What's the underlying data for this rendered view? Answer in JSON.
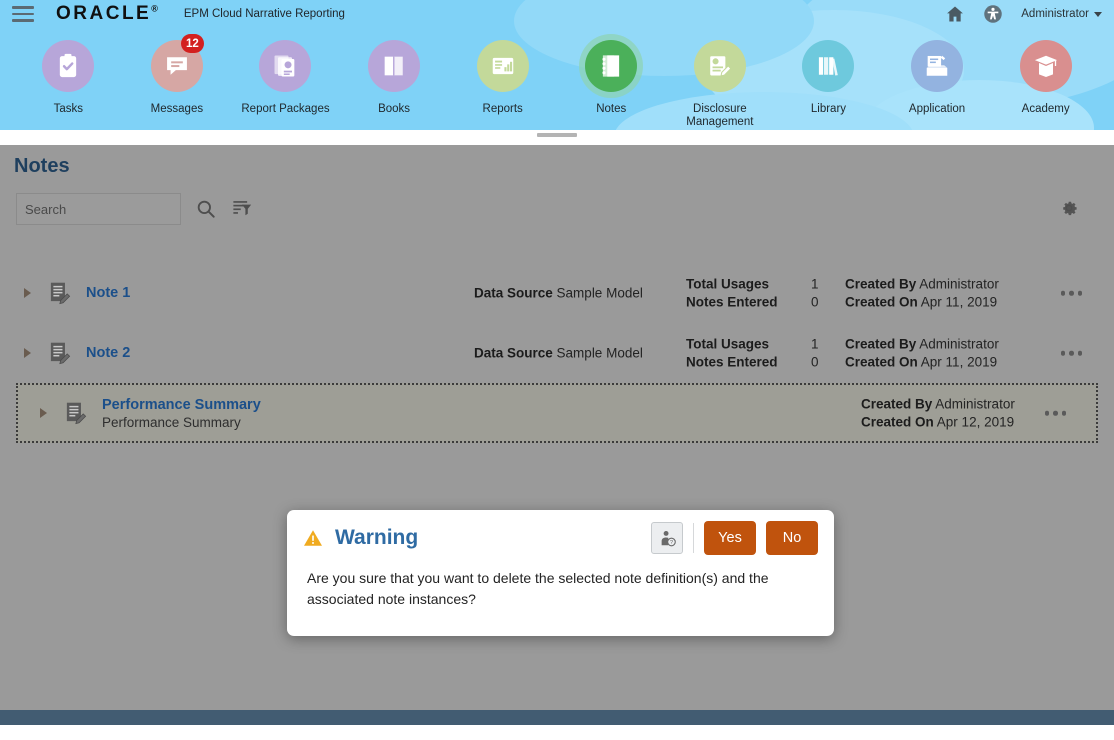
{
  "header": {
    "menu_icon": "hamburger-icon",
    "logo": "ORACLE",
    "logo_mark": "®",
    "app_title": "EPM Cloud Narrative Reporting",
    "home_icon": "home-icon",
    "accessibility_icon": "accessibility-icon",
    "user_name": "Administrator"
  },
  "nav": {
    "items": [
      {
        "label": "Tasks",
        "icon": "clipboard-check-icon",
        "circle": "#b7a6d9",
        "active": false,
        "badge": ""
      },
      {
        "label": "Messages",
        "icon": "chat-bubble-icon",
        "circle": "#d6a7a4",
        "active": false,
        "badge": "12"
      },
      {
        "label": "Report Packages",
        "icon": "report-stack-icon",
        "circle": "#b7a6d9",
        "active": false,
        "badge": ""
      },
      {
        "label": "Books",
        "icon": "book-icon",
        "circle": "#b7a6d9",
        "active": false,
        "badge": ""
      },
      {
        "label": "Reports",
        "icon": "report-chart-icon",
        "circle": "#c3d99a",
        "active": false,
        "badge": ""
      },
      {
        "label": "Notes",
        "icon": "notebook-icon",
        "circle": "#4bb05a",
        "active": true,
        "badge": ""
      },
      {
        "label": "Disclosure Management",
        "icon": "disclosure-edit-icon",
        "circle": "#c3d99a",
        "active": false,
        "badge": ""
      },
      {
        "label": "Library",
        "icon": "library-books-icon",
        "circle": "#6ec9dd",
        "active": false,
        "badge": ""
      },
      {
        "label": "Application",
        "icon": "application-tray-icon",
        "circle": "#93b3e0",
        "active": false,
        "badge": ""
      },
      {
        "label": "Academy",
        "icon": "graduation-cap-icon",
        "circle": "#d98f8f",
        "active": false,
        "badge": ""
      }
    ]
  },
  "page": {
    "title": "Notes",
    "search_placeholder": "Search",
    "search_value": "",
    "search_icon": "magnifier-icon",
    "filter_icon": "filter-list-icon",
    "settings_icon": "gear-icon"
  },
  "notes": {
    "labels": {
      "data_source": "Data Source",
      "total_usages": "Total Usages",
      "notes_entered": "Notes Entered",
      "created_by": "Created By",
      "created_on": "Created On"
    },
    "rows": [
      {
        "title": "Note 1",
        "description": "",
        "data_source": "Sample Model",
        "total_usages": "1",
        "notes_entered": "0",
        "created_by": "Administrator",
        "created_on": "Apr 11, 2019",
        "selected": false
      },
      {
        "title": "Note 2",
        "description": "",
        "data_source": "Sample Model",
        "total_usages": "1",
        "notes_entered": "0",
        "created_by": "Administrator",
        "created_on": "Apr 11, 2019",
        "selected": false
      },
      {
        "title": "Performance Summary",
        "description": "Performance Summary",
        "data_source": "",
        "total_usages": "",
        "notes_entered": "",
        "created_by": "Administrator",
        "created_on": "Apr 12, 2019",
        "selected": true
      }
    ]
  },
  "dialog": {
    "icon": "warning-triangle-icon",
    "title": "Warning",
    "message": "Are you sure that you want to delete the selected note definition(s) and the associated note instances?",
    "help_icon": "user-help-icon",
    "yes_label": "Yes",
    "no_label": "No"
  },
  "colors": {
    "header_sky": "#7fd2f7",
    "accent_blue": "#1b4f8a",
    "title_blue": "#1e3f5e",
    "dialog_title_blue": "#2f6ba3",
    "button_orange": "#c0530d",
    "badge_red": "#d3201f",
    "notes_green": "#4bb05a",
    "footer_bar": "#425c72",
    "dimmed_page": "#9a9a9a"
  }
}
